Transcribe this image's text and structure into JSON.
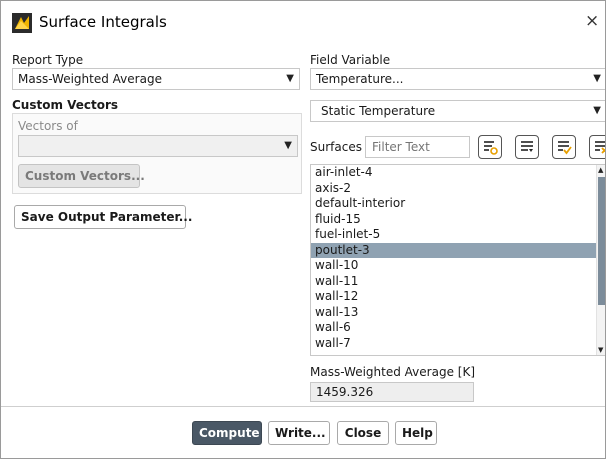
{
  "window": {
    "title": "Surface Integrals",
    "close_glyph": "×"
  },
  "report_type": {
    "label": "Report Type",
    "selected": "Mass-Weighted Average"
  },
  "custom_vectors": {
    "heading": "Custom Vectors",
    "vectors_of_label": "Vectors of",
    "selected": "",
    "button_label": "Custom Vectors..."
  },
  "save_output_parameter_label": "Save Output Parameter...",
  "field_variable": {
    "label": "Field Variable",
    "category": "Temperature...",
    "variable": "Static Temperature"
  },
  "surfaces": {
    "label": "Surfaces",
    "filter_placeholder": "Filter Text",
    "items": [
      {
        "name": "air-inlet-4",
        "selected": false
      },
      {
        "name": "axis-2",
        "selected": false
      },
      {
        "name": "default-interior",
        "selected": false
      },
      {
        "name": "fluid-15",
        "selected": false
      },
      {
        "name": "fuel-inlet-5",
        "selected": false
      },
      {
        "name": "poutlet-3",
        "selected": true
      },
      {
        "name": "wall-10",
        "selected": false
      },
      {
        "name": "wall-11",
        "selected": false
      },
      {
        "name": "wall-12",
        "selected": false
      },
      {
        "name": "wall-13",
        "selected": false
      },
      {
        "name": "wall-6",
        "selected": false
      },
      {
        "name": "wall-7",
        "selected": false
      }
    ]
  },
  "result": {
    "label": "Mass-Weighted Average [K]",
    "value": "1459.326"
  },
  "footer": {
    "compute_label": "Compute",
    "write_label": "Write...",
    "close_label": "Close",
    "help_label": "Help"
  },
  "colors": {
    "selected_row": "#8fa2b2",
    "primary_button": "#4a5866",
    "icon_accent": "#e8a000"
  }
}
